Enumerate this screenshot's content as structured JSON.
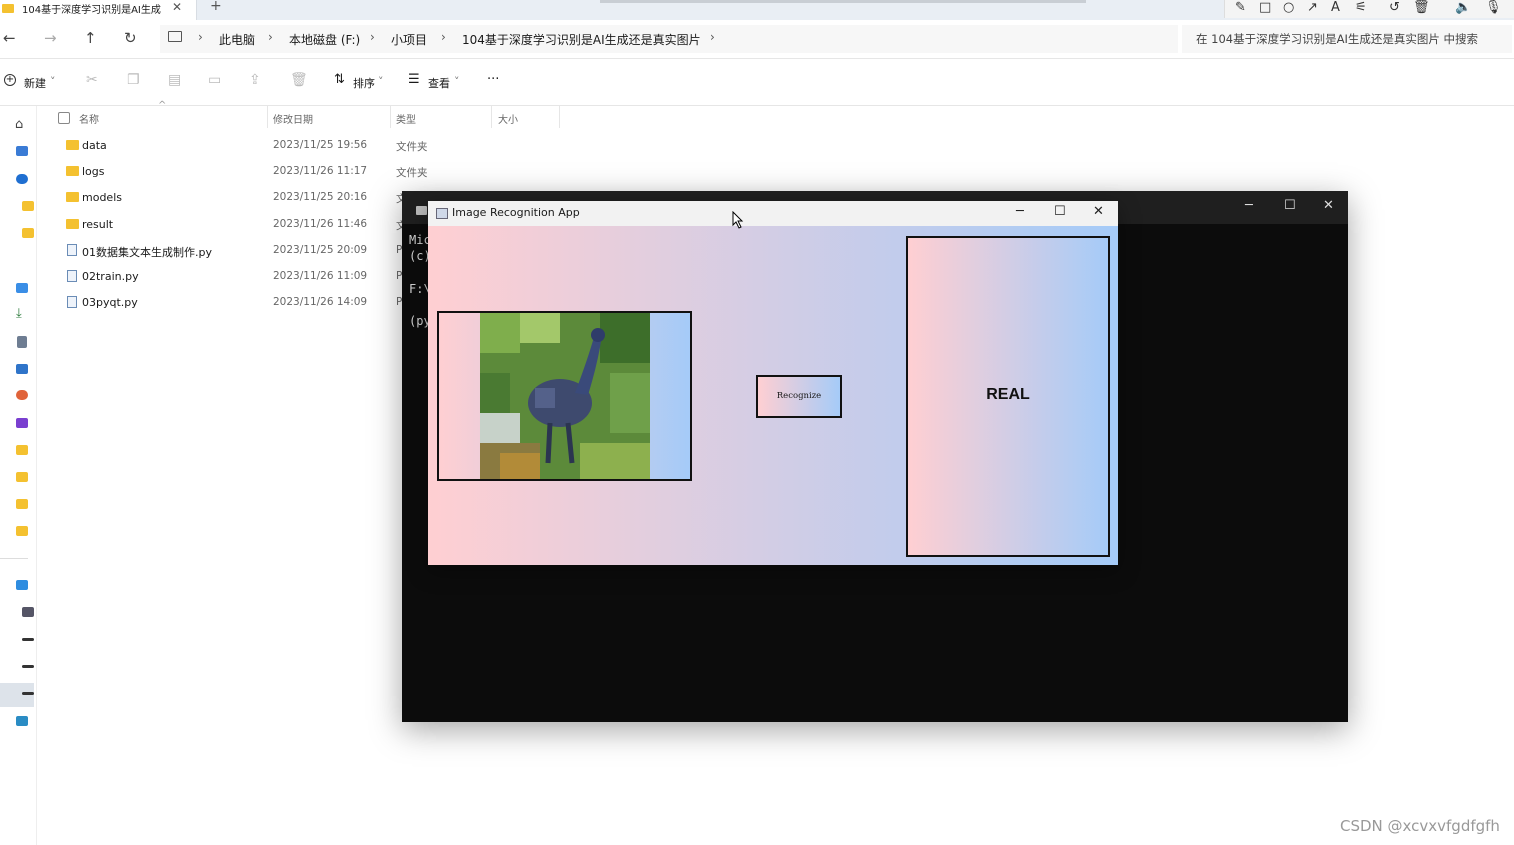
{
  "tab": {
    "title": "104基于深度学习识别是AI生成",
    "close": "✕",
    "new": "+"
  },
  "annot_tools": [
    "✎",
    "□",
    "○",
    "↗",
    "A",
    "⚟",
    "↺",
    "🗑",
    "🔈",
    "🎙"
  ],
  "nav": {
    "back": "←",
    "forward": "→",
    "up": "↑",
    "refresh": "↻"
  },
  "breadcrumb": [
    "此电脑",
    "本地磁盘 (F:)",
    "小项目",
    "104基于深度学习识别是AI生成还是真实图片"
  ],
  "search": {
    "placeholder": "在 104基于深度学习识别是AI生成还是真实图片 中搜索"
  },
  "toolbar": {
    "new_label": "新建",
    "sort_label": "排序",
    "view_label": "查看",
    "more_label": "···"
  },
  "columns": {
    "name": "名称",
    "date": "修改日期",
    "type": "类型",
    "size": "大小"
  },
  "files": [
    {
      "name": "data",
      "date": "2023/11/25 19:56",
      "type": "文件夹",
      "kind": "folder"
    },
    {
      "name": "logs",
      "date": "2023/11/26 11:17",
      "type": "文件夹",
      "kind": "folder"
    },
    {
      "name": "models",
      "date": "2023/11/25 20:16",
      "type": "文",
      "kind": "folder"
    },
    {
      "name": "result",
      "date": "2023/11/26 11:46",
      "type": "文",
      "kind": "folder"
    },
    {
      "name": "01数据集文本生成制作.py",
      "date": "2023/11/25 20:09",
      "type": "P",
      "kind": "py"
    },
    {
      "name": "02train.py",
      "date": "2023/11/26 11:09",
      "type": "P",
      "kind": "py"
    },
    {
      "name": "03pyqt.py",
      "date": "2023/11/26 14:09",
      "type": "P",
      "kind": "py"
    }
  ],
  "terminal": {
    "lines": [
      "Mic",
      "(c)",
      "F:\\",
      "(py"
    ]
  },
  "app": {
    "title": "Image Recognition App",
    "button_label": "Recognize",
    "result": "REAL"
  },
  "watermark": "CSDN @xcvxvfgdfgfh"
}
